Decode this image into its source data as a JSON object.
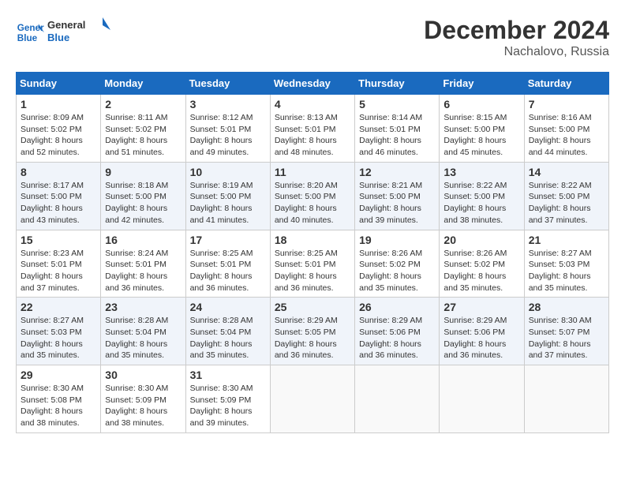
{
  "header": {
    "logo_line1": "General",
    "logo_line2": "Blue",
    "month": "December 2024",
    "location": "Nachalovo, Russia"
  },
  "weekdays": [
    "Sunday",
    "Monday",
    "Tuesday",
    "Wednesday",
    "Thursday",
    "Friday",
    "Saturday"
  ],
  "weeks": [
    [
      {
        "day": "1",
        "sunrise": "8:09 AM",
        "sunset": "5:02 PM",
        "daylight": "8 hours and 52 minutes."
      },
      {
        "day": "2",
        "sunrise": "8:11 AM",
        "sunset": "5:02 PM",
        "daylight": "8 hours and 51 minutes."
      },
      {
        "day": "3",
        "sunrise": "8:12 AM",
        "sunset": "5:01 PM",
        "daylight": "8 hours and 49 minutes."
      },
      {
        "day": "4",
        "sunrise": "8:13 AM",
        "sunset": "5:01 PM",
        "daylight": "8 hours and 48 minutes."
      },
      {
        "day": "5",
        "sunrise": "8:14 AM",
        "sunset": "5:01 PM",
        "daylight": "8 hours and 46 minutes."
      },
      {
        "day": "6",
        "sunrise": "8:15 AM",
        "sunset": "5:00 PM",
        "daylight": "8 hours and 45 minutes."
      },
      {
        "day": "7",
        "sunrise": "8:16 AM",
        "sunset": "5:00 PM",
        "daylight": "8 hours and 44 minutes."
      }
    ],
    [
      {
        "day": "8",
        "sunrise": "8:17 AM",
        "sunset": "5:00 PM",
        "daylight": "8 hours and 43 minutes."
      },
      {
        "day": "9",
        "sunrise": "8:18 AM",
        "sunset": "5:00 PM",
        "daylight": "8 hours and 42 minutes."
      },
      {
        "day": "10",
        "sunrise": "8:19 AM",
        "sunset": "5:00 PM",
        "daylight": "8 hours and 41 minutes."
      },
      {
        "day": "11",
        "sunrise": "8:20 AM",
        "sunset": "5:00 PM",
        "daylight": "8 hours and 40 minutes."
      },
      {
        "day": "12",
        "sunrise": "8:21 AM",
        "sunset": "5:00 PM",
        "daylight": "8 hours and 39 minutes."
      },
      {
        "day": "13",
        "sunrise": "8:22 AM",
        "sunset": "5:00 PM",
        "daylight": "8 hours and 38 minutes."
      },
      {
        "day": "14",
        "sunrise": "8:22 AM",
        "sunset": "5:00 PM",
        "daylight": "8 hours and 37 minutes."
      }
    ],
    [
      {
        "day": "15",
        "sunrise": "8:23 AM",
        "sunset": "5:01 PM",
        "daylight": "8 hours and 37 minutes."
      },
      {
        "day": "16",
        "sunrise": "8:24 AM",
        "sunset": "5:01 PM",
        "daylight": "8 hours and 36 minutes."
      },
      {
        "day": "17",
        "sunrise": "8:25 AM",
        "sunset": "5:01 PM",
        "daylight": "8 hours and 36 minutes."
      },
      {
        "day": "18",
        "sunrise": "8:25 AM",
        "sunset": "5:01 PM",
        "daylight": "8 hours and 36 minutes."
      },
      {
        "day": "19",
        "sunrise": "8:26 AM",
        "sunset": "5:02 PM",
        "daylight": "8 hours and 35 minutes."
      },
      {
        "day": "20",
        "sunrise": "8:26 AM",
        "sunset": "5:02 PM",
        "daylight": "8 hours and 35 minutes."
      },
      {
        "day": "21",
        "sunrise": "8:27 AM",
        "sunset": "5:03 PM",
        "daylight": "8 hours and 35 minutes."
      }
    ],
    [
      {
        "day": "22",
        "sunrise": "8:27 AM",
        "sunset": "5:03 PM",
        "daylight": "8 hours and 35 minutes."
      },
      {
        "day": "23",
        "sunrise": "8:28 AM",
        "sunset": "5:04 PM",
        "daylight": "8 hours and 35 minutes."
      },
      {
        "day": "24",
        "sunrise": "8:28 AM",
        "sunset": "5:04 PM",
        "daylight": "8 hours and 35 minutes."
      },
      {
        "day": "25",
        "sunrise": "8:29 AM",
        "sunset": "5:05 PM",
        "daylight": "8 hours and 36 minutes."
      },
      {
        "day": "26",
        "sunrise": "8:29 AM",
        "sunset": "5:06 PM",
        "daylight": "8 hours and 36 minutes."
      },
      {
        "day": "27",
        "sunrise": "8:29 AM",
        "sunset": "5:06 PM",
        "daylight": "8 hours and 36 minutes."
      },
      {
        "day": "28",
        "sunrise": "8:30 AM",
        "sunset": "5:07 PM",
        "daylight": "8 hours and 37 minutes."
      }
    ],
    [
      {
        "day": "29",
        "sunrise": "8:30 AM",
        "sunset": "5:08 PM",
        "daylight": "8 hours and 38 minutes."
      },
      {
        "day": "30",
        "sunrise": "8:30 AM",
        "sunset": "5:09 PM",
        "daylight": "8 hours and 38 minutes."
      },
      {
        "day": "31",
        "sunrise": "8:30 AM",
        "sunset": "5:09 PM",
        "daylight": "8 hours and 39 minutes."
      },
      null,
      null,
      null,
      null
    ]
  ],
  "labels": {
    "sunrise": "Sunrise:",
    "sunset": "Sunset:",
    "daylight": "Daylight:"
  }
}
